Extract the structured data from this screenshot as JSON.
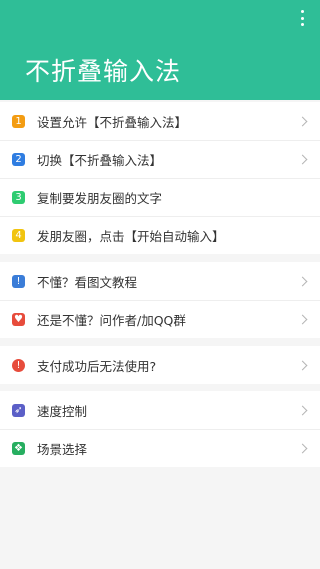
{
  "app": {
    "title": "不折叠输入法"
  },
  "header": {
    "menu_icon": "overflow-menu-icon"
  },
  "groups": [
    {
      "items": [
        {
          "label": "设置允许【不折叠输入法】",
          "icon": "1",
          "icon_color": "#f39c12",
          "chevron": true
        },
        {
          "label": "切换【不折叠输入法】",
          "icon": "2",
          "icon_color": "#2f7de1",
          "chevron": true
        },
        {
          "label": "复制要发朋友圈的文字",
          "icon": "3",
          "icon_color": "#2ecc71",
          "chevron": false
        },
        {
          "label": "发朋友圈，点击【开始自动输入】",
          "icon": "4",
          "icon_color": "#f1c40f",
          "chevron": false
        }
      ]
    },
    {
      "items": [
        {
          "label": "不懂？看图文教程",
          "icon": "!",
          "icon_color": "#3b7dd8",
          "chevron": true
        },
        {
          "label": "还是不懂？问作者/加QQ群",
          "icon": "♥",
          "icon_color": "#e74c3c",
          "chevron": true
        }
      ]
    },
    {
      "items": [
        {
          "label": "支付成功后无法使用?",
          "icon": "!",
          "icon_color": "#e74c3c",
          "chevron": true
        }
      ]
    },
    {
      "items": [
        {
          "label": "速度控制",
          "icon": "➶",
          "icon_color": "#5b5fc7",
          "chevron": true
        },
        {
          "label": "场景选择",
          "icon": "❖",
          "icon_color": "#27ae60",
          "chevron": true
        }
      ]
    }
  ]
}
